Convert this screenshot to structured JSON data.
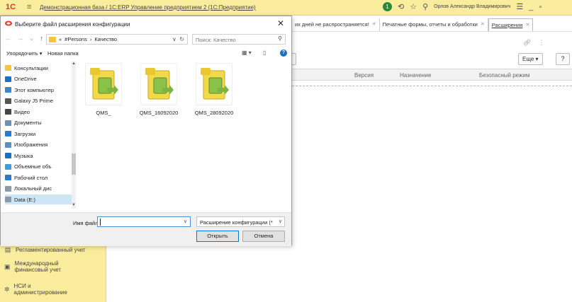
{
  "app": {
    "logo": "1С",
    "title": "Демонстрационная база / 1С:ERP Управление предприятием 2  (1С:Предприятие)",
    "user": "Орлов Александр Владимирович",
    "notifications": "1"
  },
  "sidebar": {
    "items": [
      {
        "label": "Регламентированный учет",
        "icon": "document-icon"
      },
      {
        "label": "Международный финансовый учет",
        "icon": "book-icon"
      },
      {
        "label": "НСИ и администрирование",
        "icon": "gear-icon"
      }
    ]
  },
  "tabs": [
    {
      "label": "их дней не распространяется!",
      "active": false
    },
    {
      "label": "Печатные формы, отчеты и обработки",
      "active": false
    },
    {
      "label": "Расширения",
      "active": true
    }
  ],
  "main": {
    "more_label": "Еще",
    "help_label": "?",
    "columns": [
      "Версия",
      "Назначение",
      "Безопасный режим"
    ]
  },
  "dialog": {
    "title": "Выберите файл расширения конфигурации",
    "address": {
      "prefix": "«",
      "path": [
        "#Persons",
        "Качество"
      ]
    },
    "search_placeholder": "Поиск: Качество",
    "organize_label": "Упорядочить ▾",
    "new_folder_label": "Новая папка",
    "nav_items": [
      {
        "label": "Консультации",
        "icon": "folder-icon",
        "color": "#f5c542"
      },
      {
        "label": "OneDrive",
        "icon": "cloud-icon",
        "color": "#1a6fc1"
      },
      {
        "label": "Этот компьютер",
        "icon": "computer-icon",
        "color": "#3b86c9"
      },
      {
        "label": "Galaxy J5 Prime",
        "icon": "phone-icon",
        "color": "#555555"
      },
      {
        "label": "Видео",
        "icon": "video-icon",
        "color": "#444444"
      },
      {
        "label": "Документы",
        "icon": "documents-icon",
        "color": "#6d8fb3"
      },
      {
        "label": "Загрузки",
        "icon": "download-icon",
        "color": "#2a7ad0"
      },
      {
        "label": "Изображения",
        "icon": "pictures-icon",
        "color": "#5d8ec4"
      },
      {
        "label": "Музыка",
        "icon": "music-icon",
        "color": "#1a6fc1"
      },
      {
        "label": "Объемные объ",
        "icon": "3d-objects-icon",
        "color": "#3fa0d8"
      },
      {
        "label": "Рабочий стол",
        "icon": "desktop-icon",
        "color": "#2a7ad0"
      },
      {
        "label": "Локальный дис",
        "icon": "drive-icon",
        "color": "#8a9aa8"
      },
      {
        "label": "Data (E:)",
        "icon": "drive-icon",
        "color": "#8a9aa8",
        "selected": true
      }
    ],
    "files": [
      {
        "name": "QMS_",
        "icon": "cfe-file-icon"
      },
      {
        "name": "QMS_16092020",
        "icon": "cfe-file-icon"
      },
      {
        "name": "QMS_28092020",
        "icon": "cfe-file-icon"
      }
    ],
    "filename_label": "Имя файла:",
    "filename_value": "",
    "filter_value": "Расширение конфигурации (*",
    "open_label": "Открыть",
    "cancel_label": "Отмена"
  }
}
